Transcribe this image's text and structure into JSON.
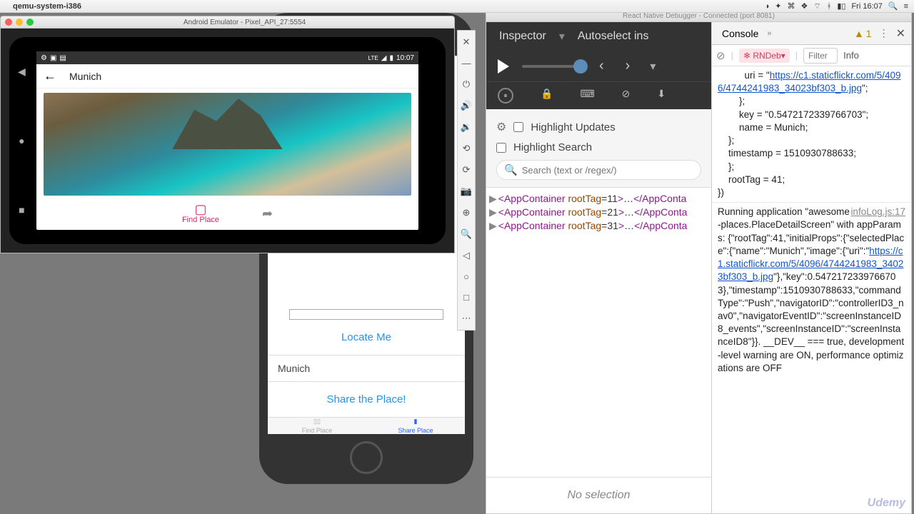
{
  "menubar": {
    "app": "qemu-system-i386",
    "clock": "Fri 16:07"
  },
  "emuWindow": {
    "title": "Android Emulator - Pixel_API_27:5554"
  },
  "androidStatus": {
    "time": "10:07"
  },
  "landscapeApp": {
    "title": "Munich",
    "findLabel": "Find Place"
  },
  "portraitApp": {
    "locate": "Locate Me",
    "placeInput": "Munich",
    "shareBtn": "Share the Place!",
    "tabFind": "Find Place",
    "tabShare": "Share Place"
  },
  "debugger": {
    "title": "React Native Debugger - Connected (port 8081)",
    "tabs": {
      "inspector": "Inspector",
      "autoselect": "Autoselect ins"
    },
    "options": {
      "highlightUpdates": "Highlight Updates",
      "highlightSearch": "Highlight Search",
      "searchPlaceholder": "Search (text or /regex/)"
    },
    "tree": {
      "row1": "<AppContainer rootTag=11>…</AppConta",
      "row2": "<AppContainer rootTag=21>…</AppConta",
      "row3": "<AppContainer rootTag=31>…</AppConta"
    },
    "noSelection": "No selection"
  },
  "console": {
    "tab": "Console",
    "warnCount": "1",
    "context": "❄ RNDeb▾",
    "filterPlaceholder": "Filter",
    "info": "Info",
    "log1_pre": "          uri = \"",
    "log1_url": "https://c1.staticflickr.com/5/4096/4744241983_34023bf303_b.jpg",
    "log1_post": "\";\n        };\n        key = \"0.5472172339766703\";\n        name = Munich;\n    };\n    timestamp = 1510930788633;\n    };\n    rootTag = 41;\n})",
    "log2_src": "infoLog.js:17",
    "log2_a": "Running application \"awesome-places.PlaceDetailScreen\" with appParams: {\"rootTag\":41,\"initialProps\":{\"selectedPlace\":{\"name\":\"Munich\",\"image\":{\"uri\":\"",
    "log2_url": "https://c1.staticflickr.com/5/4096/4744241983_34023bf303_b.jpg",
    "log2_b": "\"},\"key\":0.5472172339766703},\"timestamp\":1510930788633,\"commandType\":\"Push\",\"navigatorID\":\"controllerID3_nav0\",\"navigatorEventID\":\"screenInstanceID8_events\",\"screenInstanceID\":\"screenInstanceID8\"}}. __DEV__ === true, development-level warning are ON, performance optimizations are OFF"
  },
  "watermark": "Udemy"
}
